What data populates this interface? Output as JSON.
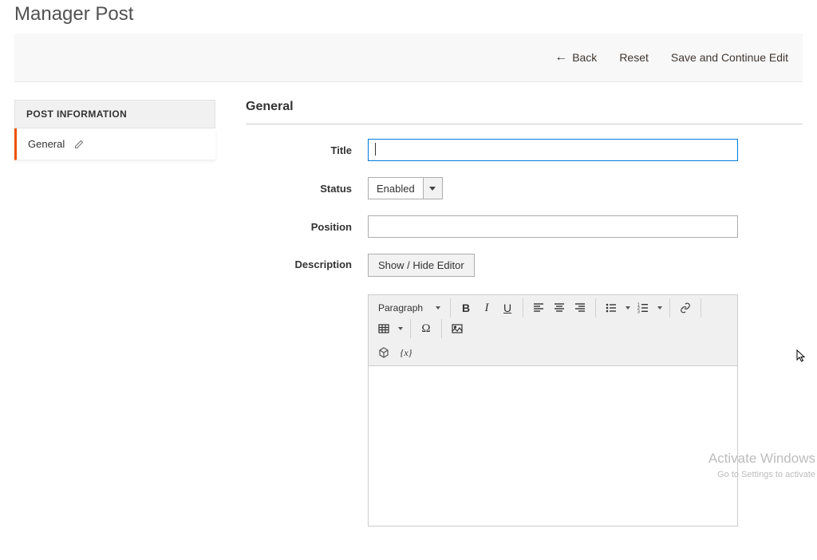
{
  "page": {
    "title": "Manager Post"
  },
  "actions": {
    "back": "Back",
    "reset": "Reset",
    "save_continue": "Save and Continue Edit"
  },
  "sidebar": {
    "title": "POST INFORMATION",
    "items": [
      {
        "label": "General"
      }
    ]
  },
  "section": {
    "title": "General"
  },
  "form": {
    "title_label": "Title",
    "title_value": "",
    "status_label": "Status",
    "status_value": "Enabled",
    "position_label": "Position",
    "position_value": "",
    "description_label": "Description",
    "toggle_editor_label": "Show / Hide Editor"
  },
  "editor": {
    "paragraph_label": "Paragraph"
  },
  "icons": {
    "edit": "edit-icon",
    "bold": "bold-icon",
    "italic": "italic-icon",
    "underline": "underline-icon",
    "align_left": "align-left-icon",
    "align_center": "align-center-icon",
    "align_right": "align-right-icon",
    "bullet_list": "bullet-list-icon",
    "number_list": "number-list-icon",
    "link": "link-icon",
    "table": "table-icon",
    "omega": "special-char-icon",
    "image": "image-icon",
    "widget": "widget-icon",
    "variable": "variable-icon"
  },
  "watermark": {
    "title": "Activate Windows",
    "sub": "Go to Settings to activate"
  }
}
